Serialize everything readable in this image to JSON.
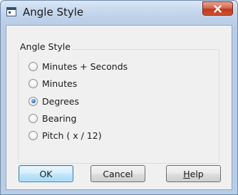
{
  "window": {
    "title": "Angle Style",
    "icon": "app-icon",
    "close_icon": "close-icon"
  },
  "group": {
    "label": "Angle Style",
    "selected_index": 2,
    "options": [
      {
        "label": "Minutes + Seconds",
        "checked": false
      },
      {
        "label": "Minutes",
        "checked": false
      },
      {
        "label": "Degrees",
        "checked": true
      },
      {
        "label": "Bearing",
        "checked": false
      },
      {
        "label": "Pitch ( x / 12)",
        "checked": false
      }
    ]
  },
  "buttons": {
    "ok": "OK",
    "cancel": "Cancel",
    "help_prefix": "H",
    "help_rest": "elp"
  },
  "colors": {
    "close_button": "#c7422a",
    "default_button_border": "#3c7fb1",
    "radio_selected": "#2a7ad8"
  }
}
